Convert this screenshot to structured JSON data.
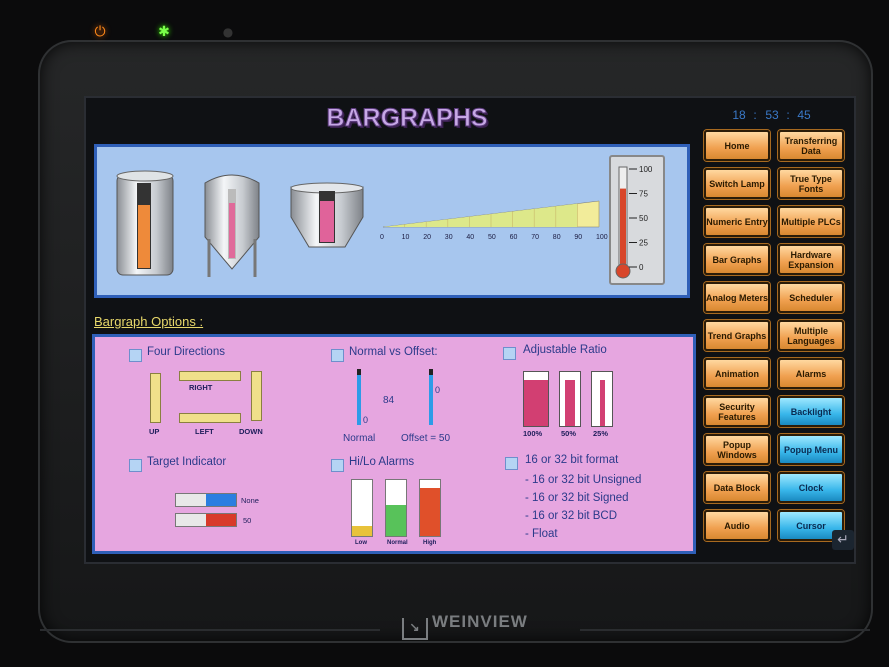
{
  "device": {
    "brand": "WEINVIEW",
    "leds": [
      "power-led",
      "run-led",
      "comm-led"
    ]
  },
  "screen": {
    "title": "BARGRAPHS",
    "clock": {
      "hours": "18",
      "minutes": "53",
      "seconds": "45",
      "separator": ":"
    },
    "top_panel": {
      "tanks": [
        {
          "name": "silo-tank",
          "fill_fraction": 0.75
        },
        {
          "name": "conical-tank",
          "fill_fraction": 0.8
        },
        {
          "name": "hopper-tank",
          "fill_fraction": 0.78
        }
      ],
      "ramp_scale": [
        "0",
        "10",
        "20",
        "30",
        "40",
        "50",
        "60",
        "70",
        "80",
        "90",
        "100"
      ],
      "ramp_fill_fraction": 0.9,
      "thermometer_scale": [
        "100",
        "75",
        "50",
        "25",
        "0"
      ],
      "thermometer_level": 0.8
    },
    "options_label": "Bargraph Options :",
    "options": {
      "four_directions": {
        "label": "Four Directions",
        "up": "UP",
        "right": "RIGHT",
        "left": "LEFT",
        "down": "DOWN"
      },
      "normal_vs_offset": {
        "label": "Normal vs Offset:",
        "value": "84",
        "normal_zero": "0",
        "offset_zero": "0",
        "normal_label": "Normal",
        "offset_label": "Offset = 50"
      },
      "adjustable_ratio": {
        "label": "Adjustable Ratio",
        "ratios": [
          "100%",
          "50%",
          "25%"
        ]
      },
      "target_indicator": {
        "label": "Target Indicator",
        "none_label": "None",
        "fifty_label": "50"
      },
      "hi_lo_alarms": {
        "label": "Hi/Lo Alarms",
        "bars": [
          {
            "label": "Low",
            "color": "#e8c23a",
            "fill_fraction": 0.18
          },
          {
            "label": "Normal",
            "color": "#58c25a",
            "fill_fraction": 0.55
          },
          {
            "label": "High",
            "color": "#e0502a",
            "fill_fraction": 0.85
          }
        ]
      },
      "format": {
        "label": "16 or 32 bit format",
        "items": [
          "- 16 or 32 bit Unsigned",
          "- 16 or 32 bit Signed",
          "- 16 or 32 bit BCD",
          "- Float"
        ]
      }
    },
    "menu_buttons": [
      {
        "label": "Home",
        "style": "orange"
      },
      {
        "label": "Transferring Data",
        "style": "orange"
      },
      {
        "label": "Switch Lamp",
        "style": "orange"
      },
      {
        "label": "True Type Fonts",
        "style": "orange"
      },
      {
        "label": "Numeric Entry",
        "style": "orange"
      },
      {
        "label": "Multiple PLCs",
        "style": "orange"
      },
      {
        "label": "Bar Graphs",
        "style": "orange"
      },
      {
        "label": "Hardware Expansion",
        "style": "orange"
      },
      {
        "label": "Analog Meters",
        "style": "orange"
      },
      {
        "label": "Scheduler",
        "style": "orange"
      },
      {
        "label": "Trend Graphs",
        "style": "orange"
      },
      {
        "label": "Multiple Languages",
        "style": "orange"
      },
      {
        "label": "Animation",
        "style": "orange"
      },
      {
        "label": "Alarms",
        "style": "orange"
      },
      {
        "label": "Security Features",
        "style": "orange"
      },
      {
        "label": "Backlight",
        "style": "blue"
      },
      {
        "label": "Popup Windows",
        "style": "orange"
      },
      {
        "label": "Popup Menu",
        "style": "blue"
      },
      {
        "label": "Data Block",
        "style": "orange"
      },
      {
        "label": "Clock",
        "style": "blue"
      },
      {
        "label": "Audio",
        "style": "orange"
      },
      {
        "label": "Cursor",
        "style": "blue"
      }
    ],
    "colors": {
      "panel_blue": "#a7c6ee",
      "panel_pink": "#e6a6e0",
      "accent_pink": "#e05a8a",
      "title_purple": "#c7a8e6"
    }
  }
}
